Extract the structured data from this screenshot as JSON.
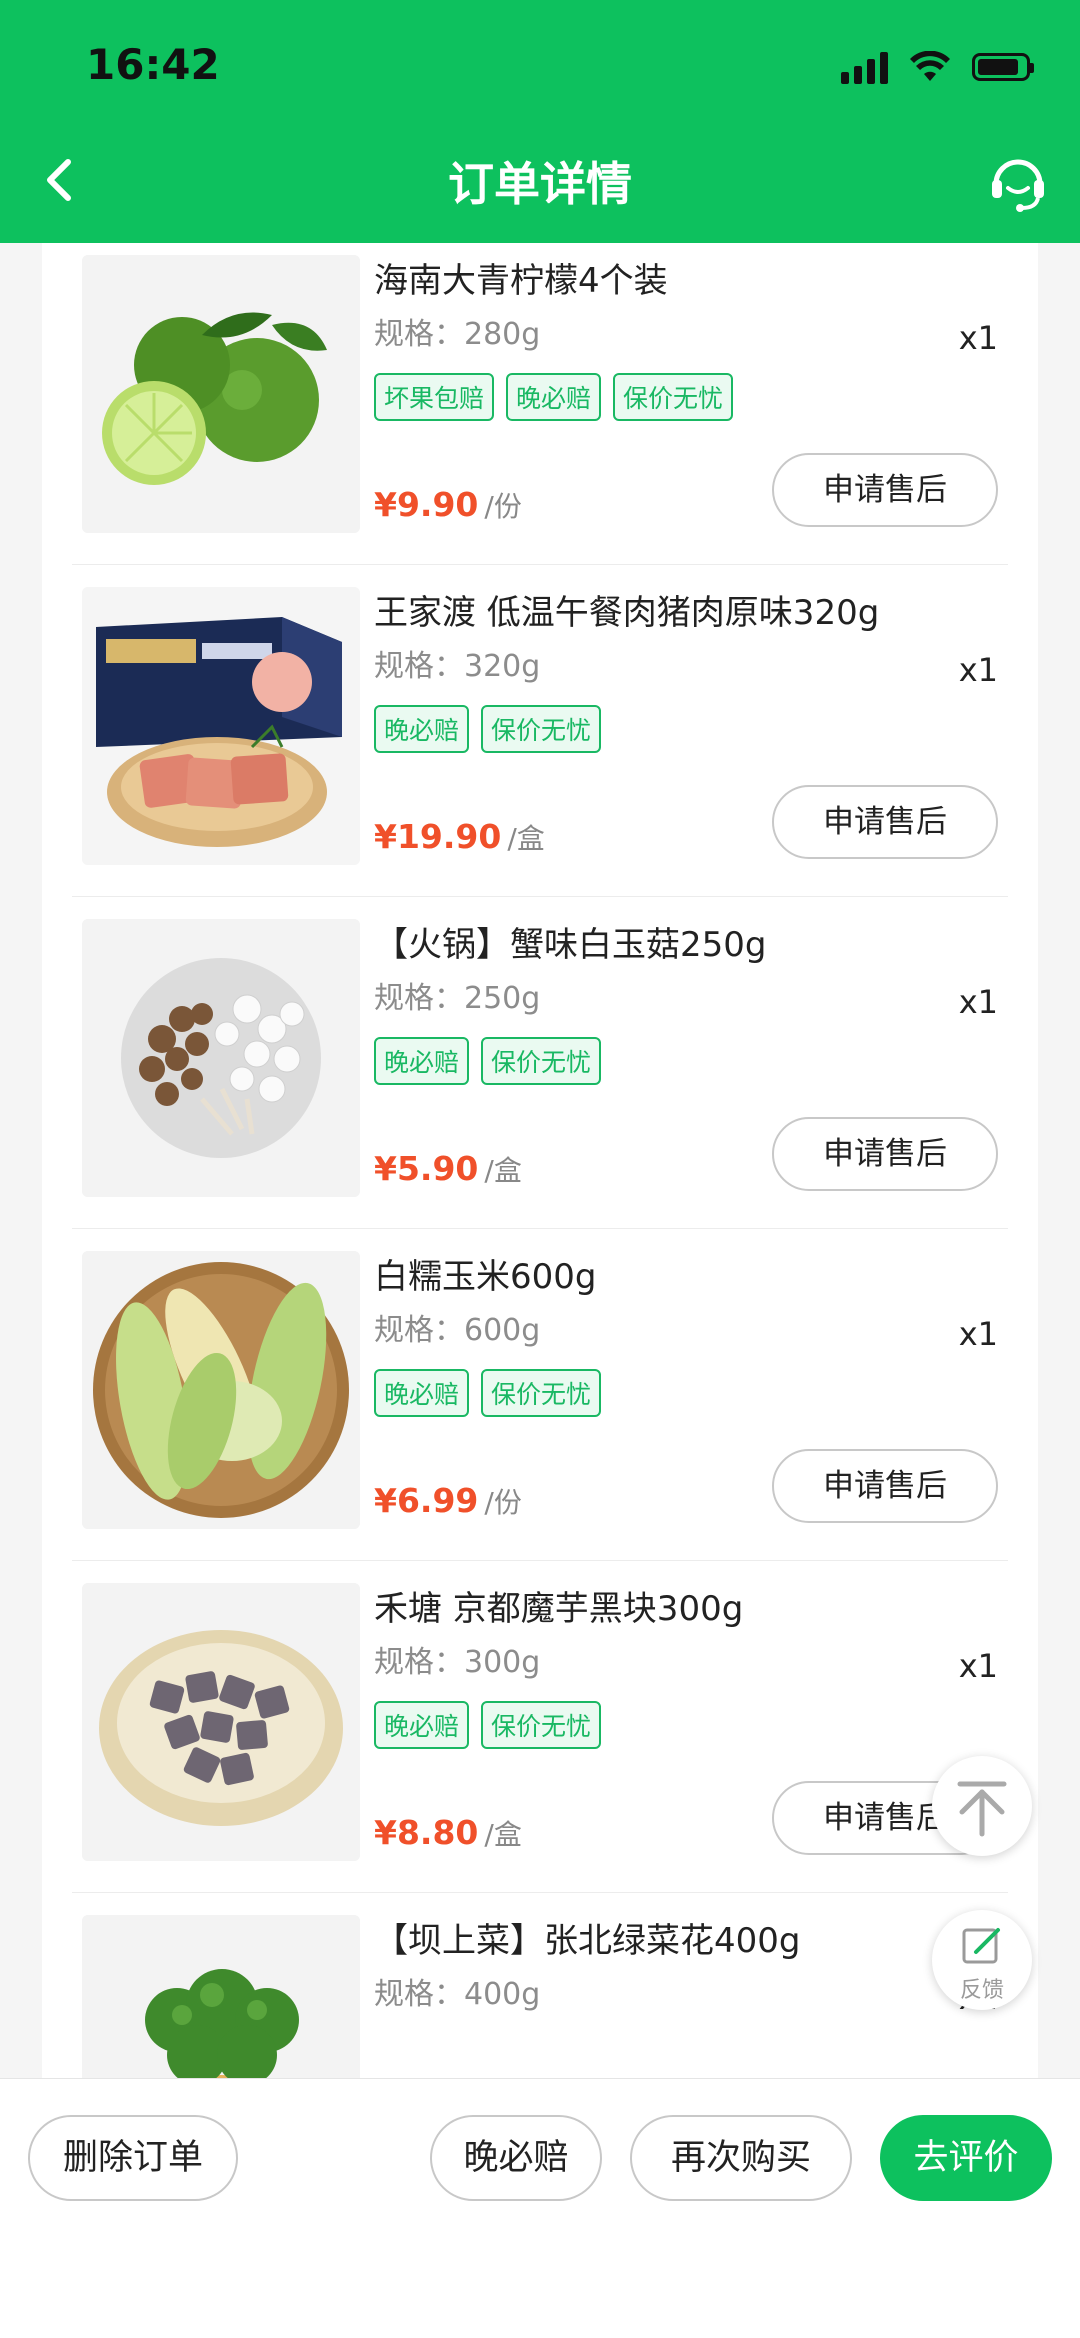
{
  "status_bar": {
    "time": "16:42"
  },
  "nav": {
    "title": "订单详情",
    "back_icon": "chevron-left-icon",
    "service_icon": "headset-icon"
  },
  "colors": {
    "brand": "#0dc15e",
    "price": "#f0502a",
    "tag": "#19b863"
  },
  "items": [
    {
      "name": "海南大青柠檬4个装",
      "spec": "规格：280g",
      "qty": "x1",
      "tags": [
        "坏果包赔",
        "晚必赔",
        "保价无忧"
      ],
      "price": "¥9.90",
      "unit": "/份",
      "action": "申请售后",
      "image": "lime"
    },
    {
      "name": "王家渡 低温午餐肉猪肉原味320g",
      "spec": "规格：320g",
      "qty": "x1",
      "tags": [
        "晚必赔",
        "保价无忧"
      ],
      "price": "¥19.90",
      "unit": "/盒",
      "action": "申请售后",
      "image": "luncheon-meat"
    },
    {
      "name": "【火锅】蟹味白玉菇250g",
      "spec": "规格：250g",
      "qty": "x1",
      "tags": [
        "晚必赔",
        "保价无忧"
      ],
      "price": "¥5.90",
      "unit": "/盒",
      "action": "申请售后",
      "image": "mushroom"
    },
    {
      "name": "白糯玉米600g",
      "spec": "规格：600g",
      "qty": "x1",
      "tags": [
        "晚必赔",
        "保价无忧"
      ],
      "price": "¥6.99",
      "unit": "/份",
      "action": "申请售后",
      "image": "corn"
    },
    {
      "name": "禾塘 京都魔芋黑块300g",
      "spec": "规格：300g",
      "qty": "x1",
      "tags": [
        "晚必赔",
        "保价无忧"
      ],
      "price": "¥8.80",
      "unit": "/盒",
      "action": "申请售后",
      "image": "konjac"
    },
    {
      "name": "【坝上菜】张北绿菜花400g",
      "spec": "规格：400g",
      "qty": "x1",
      "tags": [],
      "price": "",
      "unit": "",
      "action": "",
      "image": "broccoli"
    }
  ],
  "floating": {
    "top_icon": "back-to-top-icon",
    "feedback_icon": "feedback-edit-icon",
    "feedback_label": "反馈"
  },
  "bottom_bar": {
    "delete_label": "删除订单",
    "late_comp_label": "晚必赔",
    "rebuy_label": "再次购买",
    "review_label": "去评价"
  }
}
